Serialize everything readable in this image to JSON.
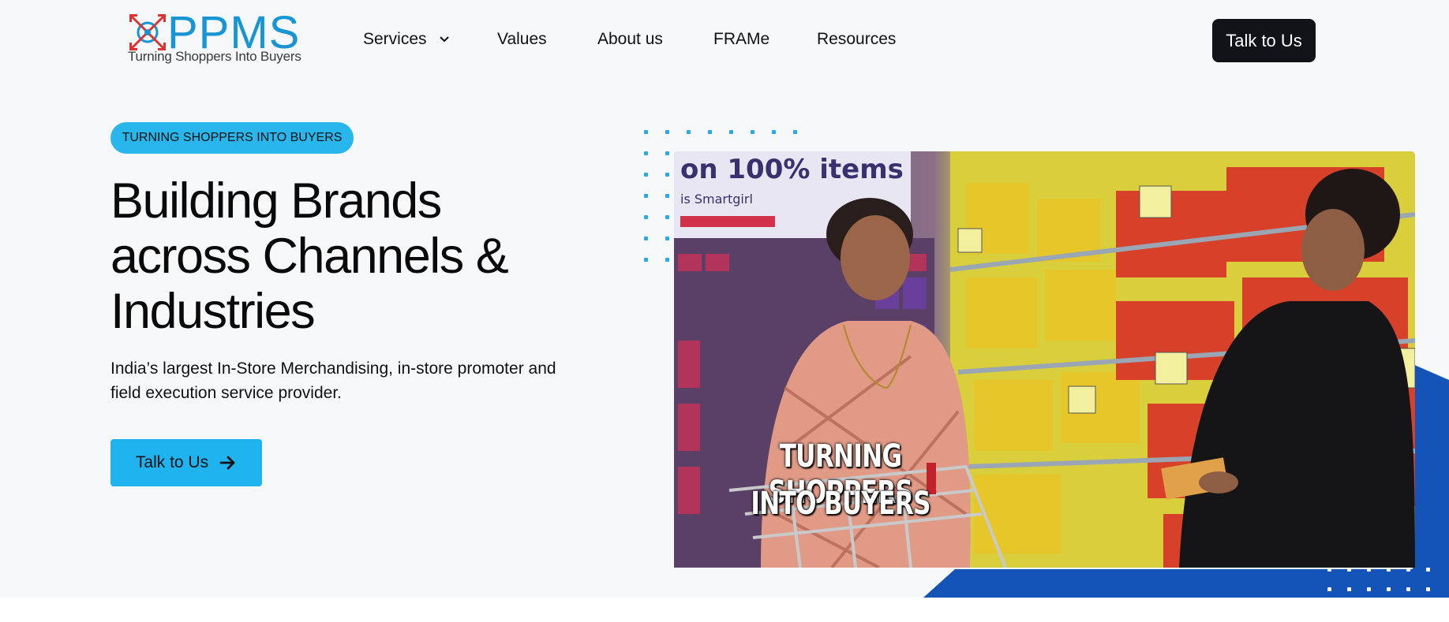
{
  "header": {
    "logo_text": "PPMS",
    "logo_tagline": "Turning Shoppers Into Buyers",
    "nav": [
      {
        "label": "Services",
        "has_dropdown": true
      },
      {
        "label": "Values"
      },
      {
        "label": "About us"
      },
      {
        "label": "FRAMe"
      },
      {
        "label": "Resources"
      }
    ],
    "cta_label": "Talk to Us"
  },
  "hero": {
    "badge": "TURNING SHOPPERS INTO BUYERS",
    "headline_lines": [
      "Building Brands",
      "across Channels &",
      "Industries"
    ],
    "description_lines": [
      "India’s largest In-Store Merchandising, in-store promoter and",
      "field execution service provider."
    ],
    "cta_label": "Talk to Us",
    "image_caption_lines": [
      "TURNING SHOPPERS",
      "INTO BUYERS"
    ]
  },
  "colors": {
    "accent": "#1fb4f0",
    "brand_blue": "#1795d4",
    "dark_button": "#111318",
    "blue_shape": "#1453b8"
  }
}
